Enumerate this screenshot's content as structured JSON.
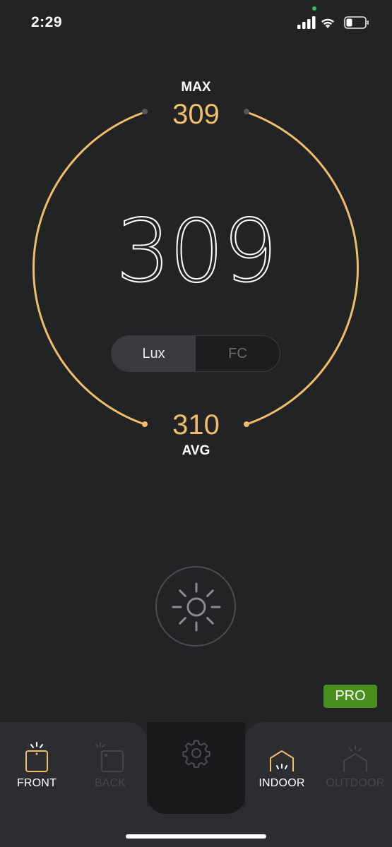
{
  "status_bar": {
    "time": "2:29",
    "icons": [
      "signal-icon",
      "wifi-icon",
      "battery-icon"
    ]
  },
  "gauge": {
    "max_label": "MAX",
    "max_value": "309",
    "current_value": "309",
    "avg_value": "310",
    "avg_label": "AVG",
    "arc_color": "#f0bd6a"
  },
  "unit_toggle": {
    "options": [
      {
        "label": "Lux",
        "selected": true
      },
      {
        "label": "FC",
        "selected": false
      }
    ]
  },
  "measure_button": {
    "icon": "sun-icon"
  },
  "pro_badge": {
    "label": "PRO",
    "color": "#4a8f1e"
  },
  "camera_tabs": [
    {
      "label": "FRONT",
      "icon": "front-camera-icon",
      "active": true
    },
    {
      "label": "BACK",
      "icon": "back-camera-icon",
      "active": false
    }
  ],
  "settings": {
    "icon": "gear-icon"
  },
  "environment_tabs": [
    {
      "label": "INDOOR",
      "icon": "indoor-house-icon",
      "active": true
    },
    {
      "label": "OUTDOOR",
      "icon": "outdoor-house-icon",
      "active": false
    }
  ],
  "colors": {
    "background": "#222325",
    "accent": "#f0bd6a",
    "panel": "#2c2d30"
  }
}
